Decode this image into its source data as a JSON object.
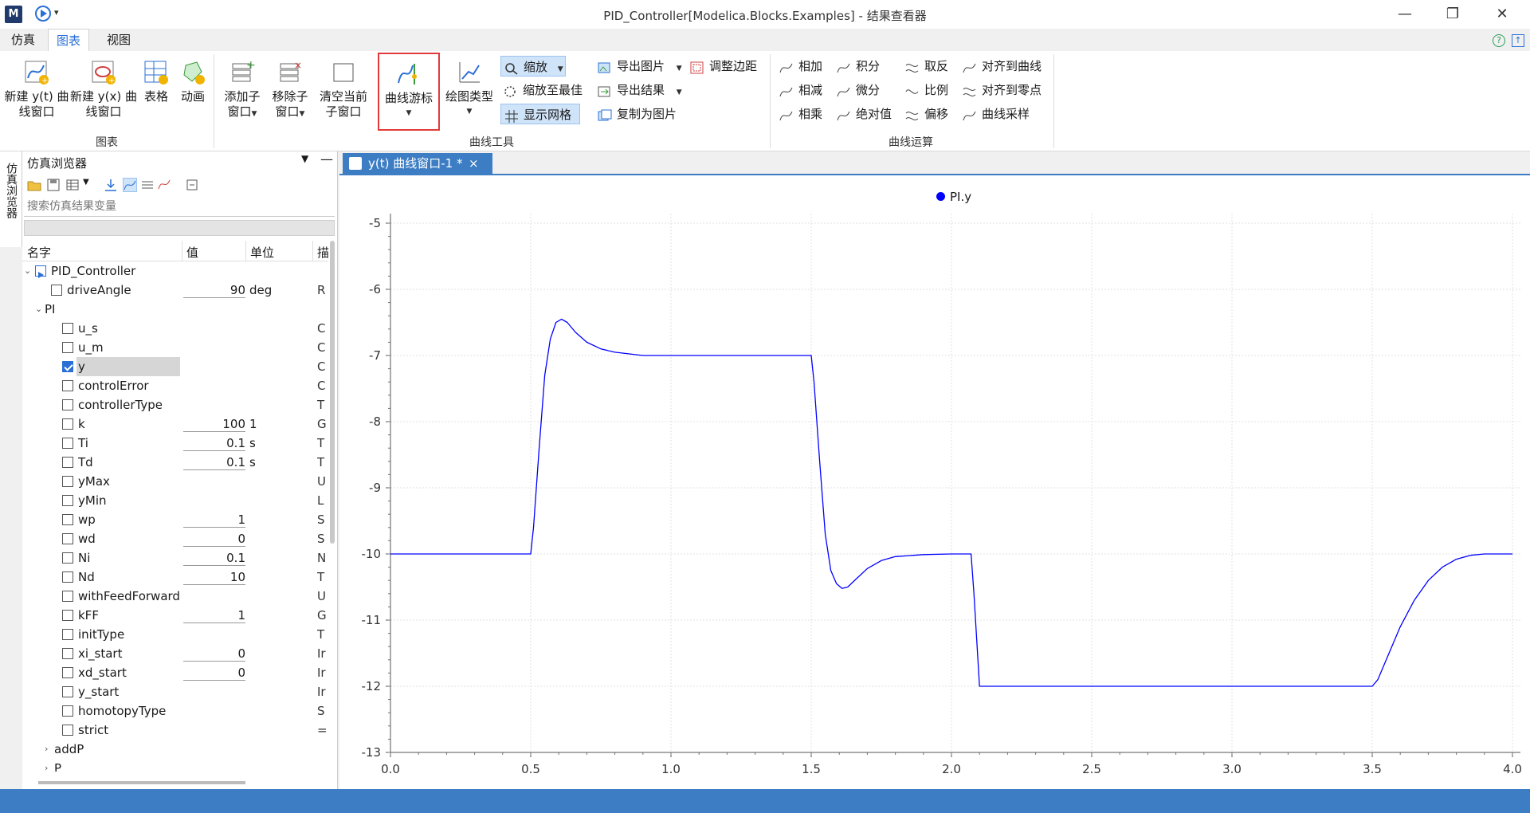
{
  "window": {
    "title": "PID_Controller[Modelica.Blocks.Examples] - 结果查看器"
  },
  "menu": {
    "tabs": [
      "仿真",
      "图表",
      "视图"
    ],
    "active": 1
  },
  "ribbon": {
    "groups": {
      "chart": "图表",
      "curve_tools": "曲线工具",
      "curve_ops": "曲线运算"
    },
    "new_yt": [
      "新建 y(t) 曲",
      "线窗口"
    ],
    "new_yx": [
      "新建 y(x) 曲",
      "线窗口"
    ],
    "table": "表格",
    "animation": "动画",
    "add_sub": [
      "添加子",
      "窗口"
    ],
    "remove_sub": [
      "移除子",
      "窗口"
    ],
    "clear_sub": [
      "清空当前",
      "子窗口"
    ],
    "cursor": "曲线游标",
    "plot_type": "绘图类型",
    "zoom": "缩放",
    "zoom_best": "缩放至最佳",
    "show_grid": "显示网格",
    "export_image": "导出图片",
    "export_result": "导出结果",
    "copy_image": "复制为图片",
    "adjust_margin": "调整边距",
    "ops": [
      "相加",
      "积分",
      "取反",
      "对齐到曲线",
      "相减",
      "微分",
      "比例",
      "对齐到零点",
      "相乘",
      "绝对值",
      "偏移",
      "曲线采样"
    ]
  },
  "sidebar": {
    "tab_label": "仿真浏览器"
  },
  "browser": {
    "title": "仿真浏览器",
    "search_placeholder": "搜索仿真结果变量",
    "columns": [
      "名字",
      "值",
      "单位",
      "描"
    ],
    "rows": [
      {
        "name": "PID_Controller",
        "value": "",
        "unit": "",
        "desc": "",
        "level": 0,
        "kind": "model",
        "expanded": true
      },
      {
        "name": "driveAngle",
        "value": "90",
        "unit": "deg",
        "desc": "R",
        "level": 1,
        "kind": "var"
      },
      {
        "name": "PI",
        "value": "",
        "unit": "",
        "desc": "",
        "level": 1,
        "kind": "group",
        "expanded": true
      },
      {
        "name": "u_s",
        "value": "",
        "unit": "",
        "desc": "C",
        "level": 2,
        "kind": "var"
      },
      {
        "name": "u_m",
        "value": "",
        "unit": "",
        "desc": "C",
        "level": 2,
        "kind": "var"
      },
      {
        "name": "y",
        "value": "",
        "unit": "",
        "desc": "C",
        "level": 2,
        "kind": "var",
        "checked": true,
        "selected": true
      },
      {
        "name": "controlError",
        "value": "",
        "unit": "",
        "desc": "C",
        "level": 2,
        "kind": "var"
      },
      {
        "name": "controllerType",
        "value": "",
        "unit": "",
        "desc": "T",
        "level": 2,
        "kind": "var"
      },
      {
        "name": "k",
        "value": "100",
        "unit": "1",
        "desc": "G",
        "level": 2,
        "kind": "var"
      },
      {
        "name": "Ti",
        "value": "0.1",
        "unit": "s",
        "desc": "T",
        "level": 2,
        "kind": "var"
      },
      {
        "name": "Td",
        "value": "0.1",
        "unit": "s",
        "desc": "T",
        "level": 2,
        "kind": "var"
      },
      {
        "name": "yMax",
        "value": "",
        "unit": "",
        "desc": "U",
        "level": 2,
        "kind": "var"
      },
      {
        "name": "yMin",
        "value": "",
        "unit": "",
        "desc": "L",
        "level": 2,
        "kind": "var"
      },
      {
        "name": "wp",
        "value": "1",
        "unit": "",
        "desc": "S",
        "level": 2,
        "kind": "var"
      },
      {
        "name": "wd",
        "value": "0",
        "unit": "",
        "desc": "S",
        "level": 2,
        "kind": "var"
      },
      {
        "name": "Ni",
        "value": "0.1",
        "unit": "",
        "desc": "N",
        "level": 2,
        "kind": "var"
      },
      {
        "name": "Nd",
        "value": "10",
        "unit": "",
        "desc": "T",
        "level": 2,
        "kind": "var"
      },
      {
        "name": "withFeedForward",
        "value": "",
        "unit": "",
        "desc": "U",
        "level": 2,
        "kind": "var"
      },
      {
        "name": "kFF",
        "value": "1",
        "unit": "",
        "desc": "G",
        "level": 2,
        "kind": "var"
      },
      {
        "name": "initType",
        "value": "",
        "unit": "",
        "desc": "T",
        "level": 2,
        "kind": "var"
      },
      {
        "name": "xi_start",
        "value": "0",
        "unit": "",
        "desc": "Ir",
        "level": 2,
        "kind": "var"
      },
      {
        "name": "xd_start",
        "value": "0",
        "unit": "",
        "desc": "Ir",
        "level": 2,
        "kind": "var"
      },
      {
        "name": "y_start",
        "value": "",
        "unit": "",
        "desc": "Ir",
        "level": 2,
        "kind": "var"
      },
      {
        "name": "homotopyType",
        "value": "",
        "unit": "",
        "desc": "S",
        "level": 2,
        "kind": "var"
      },
      {
        "name": "strict",
        "value": "",
        "unit": "",
        "desc": "=",
        "level": 2,
        "kind": "var"
      },
      {
        "name": "addP",
        "value": "",
        "unit": "",
        "desc": "",
        "level": 2,
        "kind": "group",
        "expanded": false
      },
      {
        "name": "P",
        "value": "",
        "unit": "",
        "desc": "",
        "level": 2,
        "kind": "group",
        "expanded": false
      }
    ]
  },
  "doc_tab": {
    "label": "y(t) 曲线窗口-1 *",
    "close": "×"
  },
  "chart_data": {
    "type": "line",
    "legend": "PI.y",
    "legend_position": "top-center",
    "grid": true,
    "xlim": [
      0,
      4
    ],
    "ylim": [
      -13,
      -5
    ],
    "xticks": [
      "0.0",
      "0.5",
      "1.0",
      "1.5",
      "2.0",
      "2.5",
      "3.0",
      "3.5",
      "4.0"
    ],
    "yticks": [
      "-5",
      "-6",
      "-7",
      "-8",
      "-9",
      "-10",
      "-11",
      "-12",
      "-13"
    ],
    "color": "#0000ff",
    "series": [
      {
        "name": "PI.y",
        "x": [
          0,
          0.5,
          0.51,
          0.53,
          0.55,
          0.57,
          0.59,
          0.61,
          0.63,
          0.66,
          0.7,
          0.75,
          0.8,
          0.9,
          1.0,
          1.1,
          1.2,
          1.3,
          1.4,
          1.5,
          1.51,
          1.53,
          1.55,
          1.57,
          1.59,
          1.61,
          1.63,
          1.66,
          1.7,
          1.75,
          1.8,
          1.9,
          2.0,
          2.07,
          2.08,
          2.1,
          2.5,
          3.0,
          3.5,
          3.52,
          3.55,
          3.6,
          3.65,
          3.7,
          3.75,
          3.8,
          3.85,
          3.9,
          4.0
        ],
        "y": [
          -10,
          -10,
          -9.6,
          -8.4,
          -7.3,
          -6.75,
          -6.5,
          -6.45,
          -6.5,
          -6.65,
          -6.8,
          -6.9,
          -6.95,
          -7.0,
          -7.0,
          -7.0,
          -7.0,
          -7.0,
          -7.0,
          -7.0,
          -7.4,
          -8.6,
          -9.7,
          -10.25,
          -10.45,
          -10.52,
          -10.5,
          -10.38,
          -10.22,
          -10.1,
          -10.04,
          -10.01,
          -10.0,
          -10.0,
          -10.6,
          -12.0,
          -12.0,
          -12.0,
          -12.0,
          -11.9,
          -11.6,
          -11.1,
          -10.7,
          -10.4,
          -10.2,
          -10.08,
          -10.02,
          -10.0,
          -10.0
        ]
      }
    ]
  }
}
